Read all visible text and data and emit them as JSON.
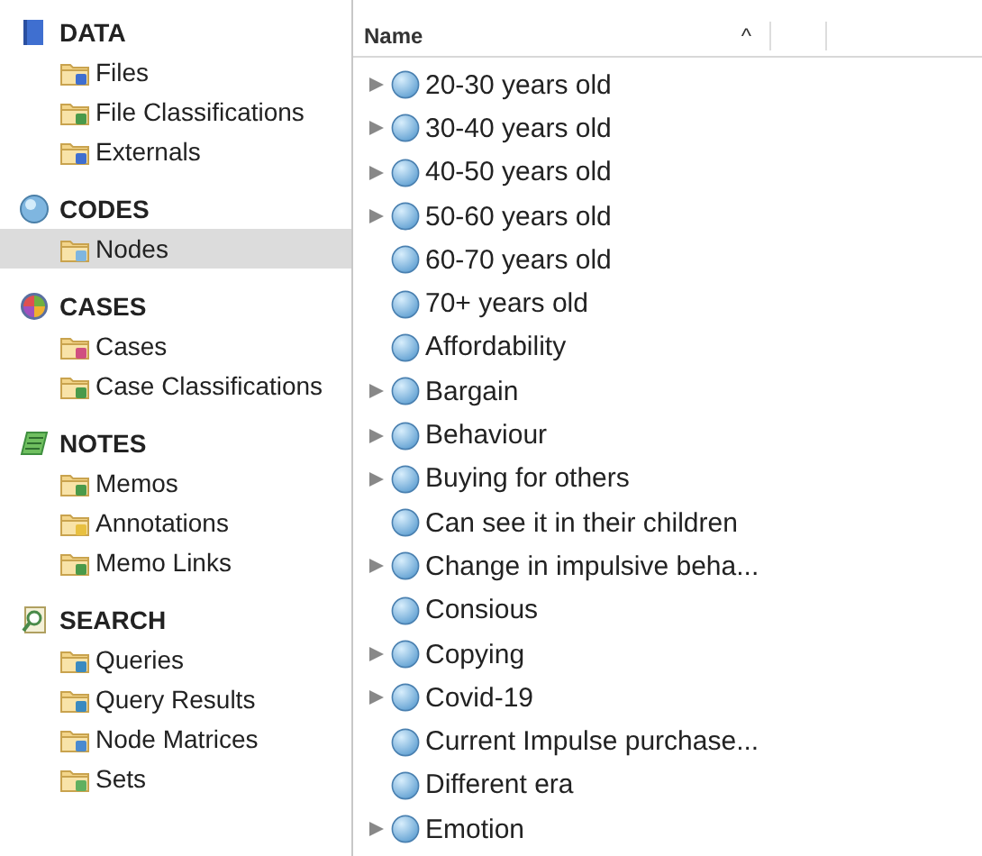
{
  "sidebar": {
    "sections": [
      {
        "title": "DATA",
        "kind": "data",
        "items": [
          {
            "label": "Files",
            "kind": "file",
            "selected": false
          },
          {
            "label": "File Classifications",
            "kind": "classification",
            "selected": false
          },
          {
            "label": "Externals",
            "kind": "external",
            "selected": false
          }
        ]
      },
      {
        "title": "CODES",
        "kind": "codes",
        "items": [
          {
            "label": "Nodes",
            "kind": "node",
            "selected": true
          }
        ]
      },
      {
        "title": "CASES",
        "kind": "cases",
        "items": [
          {
            "label": "Cases",
            "kind": "case",
            "selected": false
          },
          {
            "label": "Case Classifications",
            "kind": "classification",
            "selected": false
          }
        ]
      },
      {
        "title": "NOTES",
        "kind": "notes",
        "items": [
          {
            "label": "Memos",
            "kind": "memo",
            "selected": false
          },
          {
            "label": "Annotations",
            "kind": "annotation",
            "selected": false
          },
          {
            "label": "Memo Links",
            "kind": "memo",
            "selected": false
          }
        ]
      },
      {
        "title": "SEARCH",
        "kind": "search",
        "items": [
          {
            "label": "Queries",
            "kind": "query",
            "selected": false
          },
          {
            "label": "Query Results",
            "kind": "query",
            "selected": false
          },
          {
            "label": "Node Matrices",
            "kind": "matrix",
            "selected": false
          },
          {
            "label": "Sets",
            "kind": "set",
            "selected": false
          }
        ]
      }
    ]
  },
  "table": {
    "columns": [
      {
        "label": "Name",
        "sort_indicator": "^"
      }
    ],
    "rows": [
      {
        "name": "20-30 years old",
        "has_children": true
      },
      {
        "name": "30-40 years old",
        "has_children": true
      },
      {
        "name": "40-50 years old",
        "has_children": true
      },
      {
        "name": "50-60 years old",
        "has_children": true
      },
      {
        "name": "60-70 years old",
        "has_children": false
      },
      {
        "name": "70+ years old",
        "has_children": false
      },
      {
        "name": "Affordability",
        "has_children": false
      },
      {
        "name": "Bargain",
        "has_children": true
      },
      {
        "name": "Behaviour",
        "has_children": true
      },
      {
        "name": "Buying for others",
        "has_children": true
      },
      {
        "name": "Can see it in their children",
        "has_children": false
      },
      {
        "name": "Change in impulsive beha...",
        "has_children": true
      },
      {
        "name": "Consious",
        "has_children": false
      },
      {
        "name": "Copying",
        "has_children": true
      },
      {
        "name": "Covid-19",
        "has_children": true
      },
      {
        "name": "Current Impulse purchase...",
        "has_children": false
      },
      {
        "name": "Different era",
        "has_children": false
      },
      {
        "name": "Emotion",
        "has_children": true
      }
    ]
  }
}
